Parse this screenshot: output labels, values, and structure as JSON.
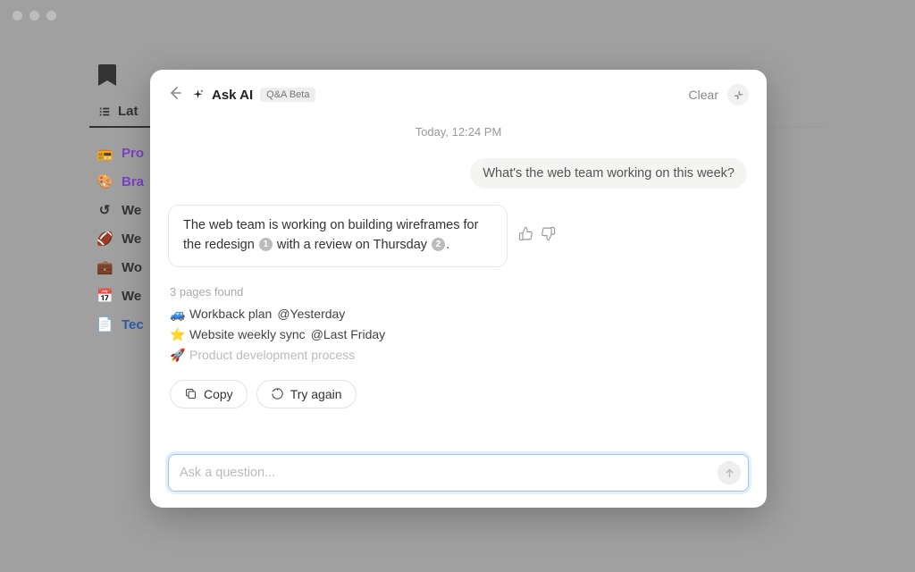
{
  "background": {
    "tab_label": "Lat",
    "items": [
      {
        "emoji": "📻",
        "label": "Pro",
        "color": "#7b43c7"
      },
      {
        "emoji": "🎨",
        "label": "Bra",
        "color": "#7b43c7"
      },
      {
        "emoji": "↺",
        "label": "We",
        "color": "#333"
      },
      {
        "emoji": "🏈",
        "label": "We",
        "color": "#333"
      },
      {
        "emoji": "💼",
        "label": "Wo",
        "color": "#333"
      },
      {
        "emoji": "📅",
        "label": "We",
        "color": "#333"
      },
      {
        "emoji": "📄",
        "label": "Tec",
        "color": "#2e5db0"
      }
    ]
  },
  "modal": {
    "title": "Ask AI",
    "badge": "Q&A Beta",
    "clear_label": "Clear",
    "timestamp": "Today, 12:24 PM",
    "user_message": "What's the web team working on this week?",
    "ai_response": {
      "parts": [
        {
          "text": "The web team is working on building wireframes for the redesign "
        },
        {
          "cite": "1"
        },
        {
          "text": " with a review on Thursday "
        },
        {
          "cite": "2"
        },
        {
          "text": "."
        }
      ]
    },
    "sources": {
      "header": "3 pages found",
      "items": [
        {
          "emoji": "🚙",
          "title": "Workback plan",
          "suffix": "@Yesterday",
          "dim": false
        },
        {
          "emoji": "⭐",
          "title": "Website weekly sync",
          "suffix": "@Last Friday",
          "dim": false
        },
        {
          "emoji": "🚀",
          "title": "Product development process",
          "suffix": "",
          "dim": true
        }
      ]
    },
    "actions": {
      "copy": "Copy",
      "try_again": "Try again"
    },
    "input_placeholder": "Ask a question..."
  }
}
